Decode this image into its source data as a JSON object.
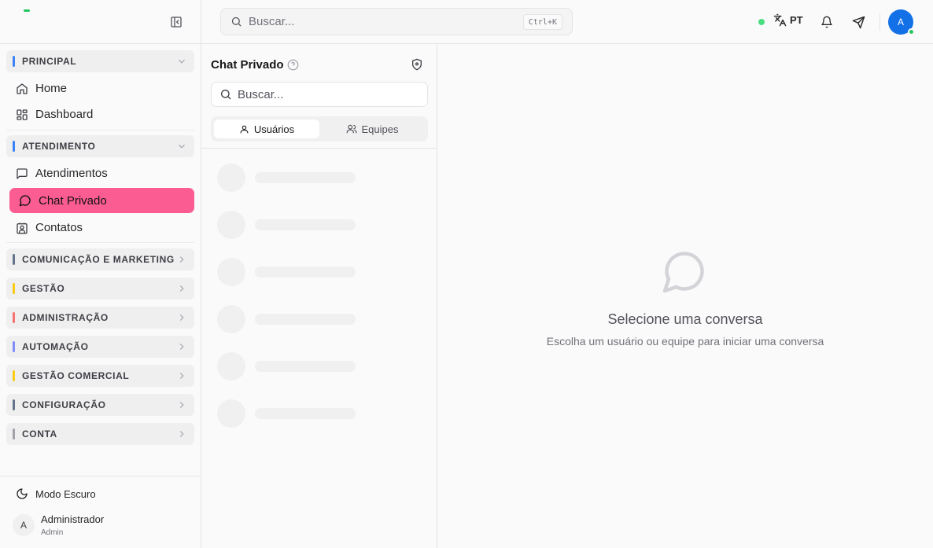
{
  "sidebar": {
    "groups": {
      "principal": {
        "label": "PRINCIPAL",
        "color": "#3b82f6"
      },
      "atendimento": {
        "label": "ATENDIMENTO",
        "color": "#3b82f6"
      },
      "comunicacao": {
        "label": "COMUNICAÇÃO E MARKETING",
        "color": "#64748b"
      },
      "gestao": {
        "label": "GESTÃO",
        "color": "#facc15"
      },
      "administracao": {
        "label": "ADMINISTRAÇÃO",
        "color": "#f87171"
      },
      "automacao": {
        "label": "AUTOMAÇÃO",
        "color": "#818cf8"
      },
      "gestao_comercial": {
        "label": "GESTÃO COMERCIAL",
        "color": "#facc15"
      },
      "configuracao": {
        "label": "CONFIGURAÇÃO",
        "color": "#64748b"
      },
      "conta": {
        "label": "CONTA",
        "color": "#a1a1aa"
      }
    },
    "items": {
      "home": "Home",
      "dashboard": "Dashboard",
      "atendimentos": "Atendimentos",
      "chat_privado": "Chat Privado",
      "contatos": "Contatos"
    },
    "dark_mode_label": "Modo Escuro",
    "user": {
      "initial": "A",
      "name": "Administrador",
      "role": "Admin"
    }
  },
  "topbar": {
    "search_placeholder": "Buscar...",
    "shortcut": "Ctrl+K",
    "language": "PT",
    "avatar_initial": "A",
    "accent_color": "#1470e6"
  },
  "chat": {
    "title": "Chat Privado",
    "search_placeholder": "Buscar...",
    "tabs": {
      "users": "Usuários",
      "teams": "Equipes"
    },
    "active_tab": "users"
  },
  "empty_state": {
    "title": "Selecione uma conversa",
    "subtitle": "Escolha um usuário ou equipe para iniciar uma conversa"
  },
  "active_nav_color": "#fb5c91"
}
